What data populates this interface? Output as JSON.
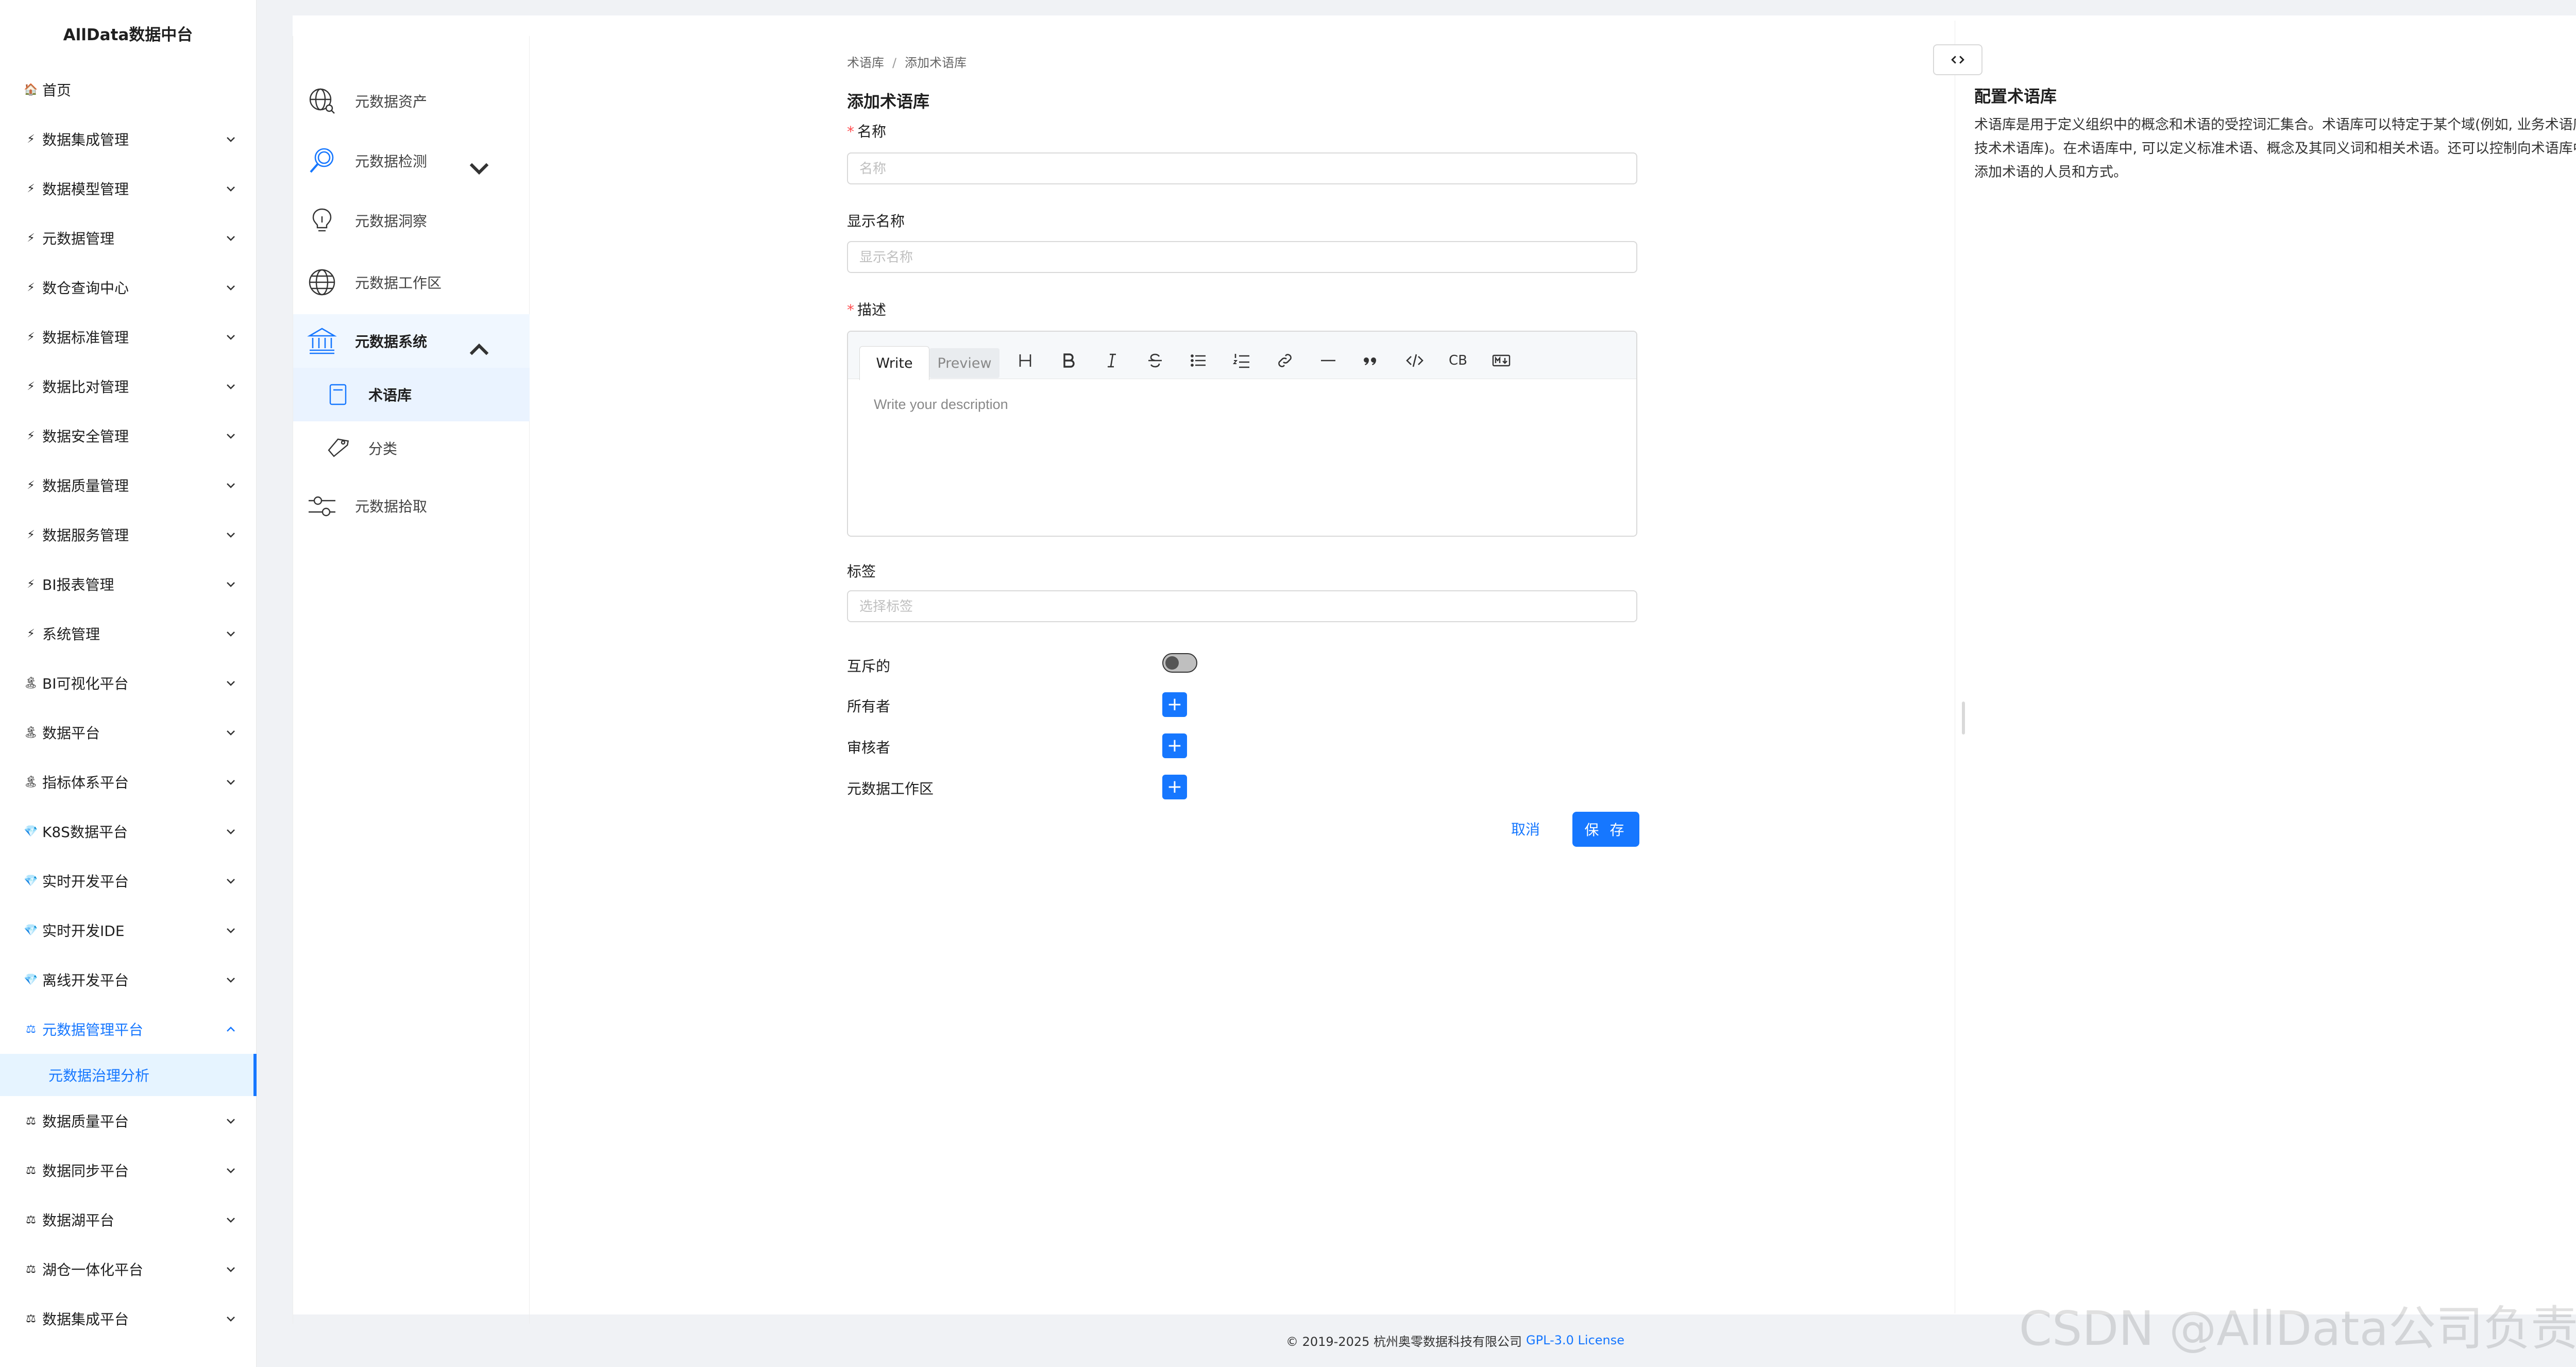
{
  "sidebar": {
    "brand": "AllData数据中台",
    "items": [
      {
        "label": "首页",
        "icon": "🏠"
      },
      {
        "label": "数据集成管理",
        "icon": "⚡"
      },
      {
        "label": "数据模型管理",
        "icon": "⚡"
      },
      {
        "label": "元数据管理",
        "icon": "⚡"
      },
      {
        "label": "数仓查询中心",
        "icon": "⚡"
      },
      {
        "label": "数据标准管理",
        "icon": "⚡"
      },
      {
        "label": "数据比对管理",
        "icon": "⚡"
      },
      {
        "label": "数据安全管理",
        "icon": "⚡"
      },
      {
        "label": "数据质量管理",
        "icon": "⚡"
      },
      {
        "label": "数据服务管理",
        "icon": "⚡"
      },
      {
        "label": "BI报表管理",
        "icon": "⚡"
      },
      {
        "label": "系统管理",
        "icon": "⚡"
      },
      {
        "label": "BI可视化平台",
        "icon": "🏝"
      },
      {
        "label": "数据平台",
        "icon": "🏝"
      },
      {
        "label": "指标体系平台",
        "icon": "🏝"
      },
      {
        "label": "K8S数据平台",
        "icon": "💎"
      },
      {
        "label": "实时开发平台",
        "icon": "💎"
      },
      {
        "label": "实时开发IDE",
        "icon": "💎"
      },
      {
        "label": "离线开发平台",
        "icon": "💎"
      },
      {
        "label": "元数据管理平台",
        "icon": "⚖"
      },
      {
        "label": "数据质量平台",
        "icon": "⚖"
      },
      {
        "label": "数据同步平台",
        "icon": "⚖"
      },
      {
        "label": "数据湖平台",
        "icon": "⚖"
      },
      {
        "label": "湖仓一体化平台",
        "icon": "⚖"
      },
      {
        "label": "数据集成平台",
        "icon": "⚖"
      }
    ],
    "active_sub": "元数据治理分析"
  },
  "subnav": {
    "assets": "元数据资产",
    "detect": "元数据检测",
    "insight": "元数据洞察",
    "workspace": "元数据工作区",
    "system": "元数据系统",
    "glossary": "术语库",
    "classification": "分类",
    "ingestion": "元数据拾取"
  },
  "breadcrumb": {
    "parent": "术语库",
    "current": "添加术语库"
  },
  "form": {
    "title": "添加术语库",
    "name_label": "名称",
    "name_placeholder": "名称",
    "display_label": "显示名称",
    "display_placeholder": "显示名称",
    "desc_label": "描述",
    "tab_write": "Write",
    "tab_preview": "Preview",
    "tool_cb": "CB",
    "desc_placeholder": "Write your description",
    "tags_label": "标签",
    "tags_placeholder": "选择标签",
    "mutex_label": "互斥的",
    "owner_label": "所有者",
    "reviewer_label": "审核者",
    "workspace_label": "元数据工作区",
    "cancel": "取消",
    "save": "保 存"
  },
  "help": {
    "title": "配置术语库",
    "body": "术语库是用于定义组织中的概念和术语的受控词汇集合。术语库可以特定于某个域(例如, 业务术语库, 技术术语库)。在术语库中, 可以定义标准术语、概念及其同义词和相关术语。还可以控制向术语库中添加术语的人员和方式。"
  },
  "footer": {
    "copyright": "© 2019-2025 杭州奥零数据科技有限公司",
    "license": "GPL-3.0 License"
  },
  "watermark": "CSDN @AllData公司负责人"
}
